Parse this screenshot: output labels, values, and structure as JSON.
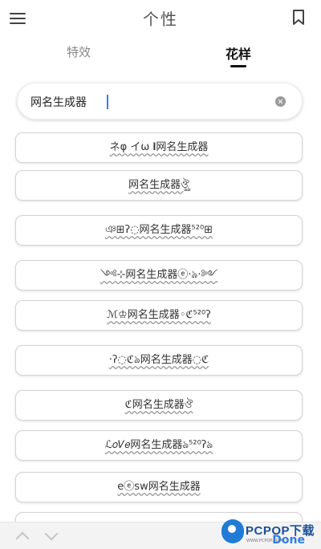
{
  "header": {
    "title": "个性"
  },
  "tabs": [
    {
      "label": "特效"
    },
    {
      "label": "花样"
    }
  ],
  "search": {
    "value": "网名生成器"
  },
  "results": [
    "ネφ イω 𝐈网名生成器",
    "网名生成器ঔৣ",
    "ঞ⊞ʔ◌网名生成器⁵²⁰⊞",
    "༺⊹网名生成器ⓔ·ঌ·༻",
    "ℳ♔网名生成器◦ℭ⁵²⁰ʔ",
    "·ʔ◌ℭঌ网名生成器◌ℭ",
    "ℭ网名生成器ঔ",
    "ℒ𝑜𝑉𝑒网名生成器ঌ⁵²⁰ʔঌ",
    "eⓔsw网名生成器"
  ],
  "bottom_bar": {
    "done_label": "Done"
  },
  "watermark": {
    "text": "PCPOP下载",
    "sub": "WWW.PCPOP.COM"
  }
}
